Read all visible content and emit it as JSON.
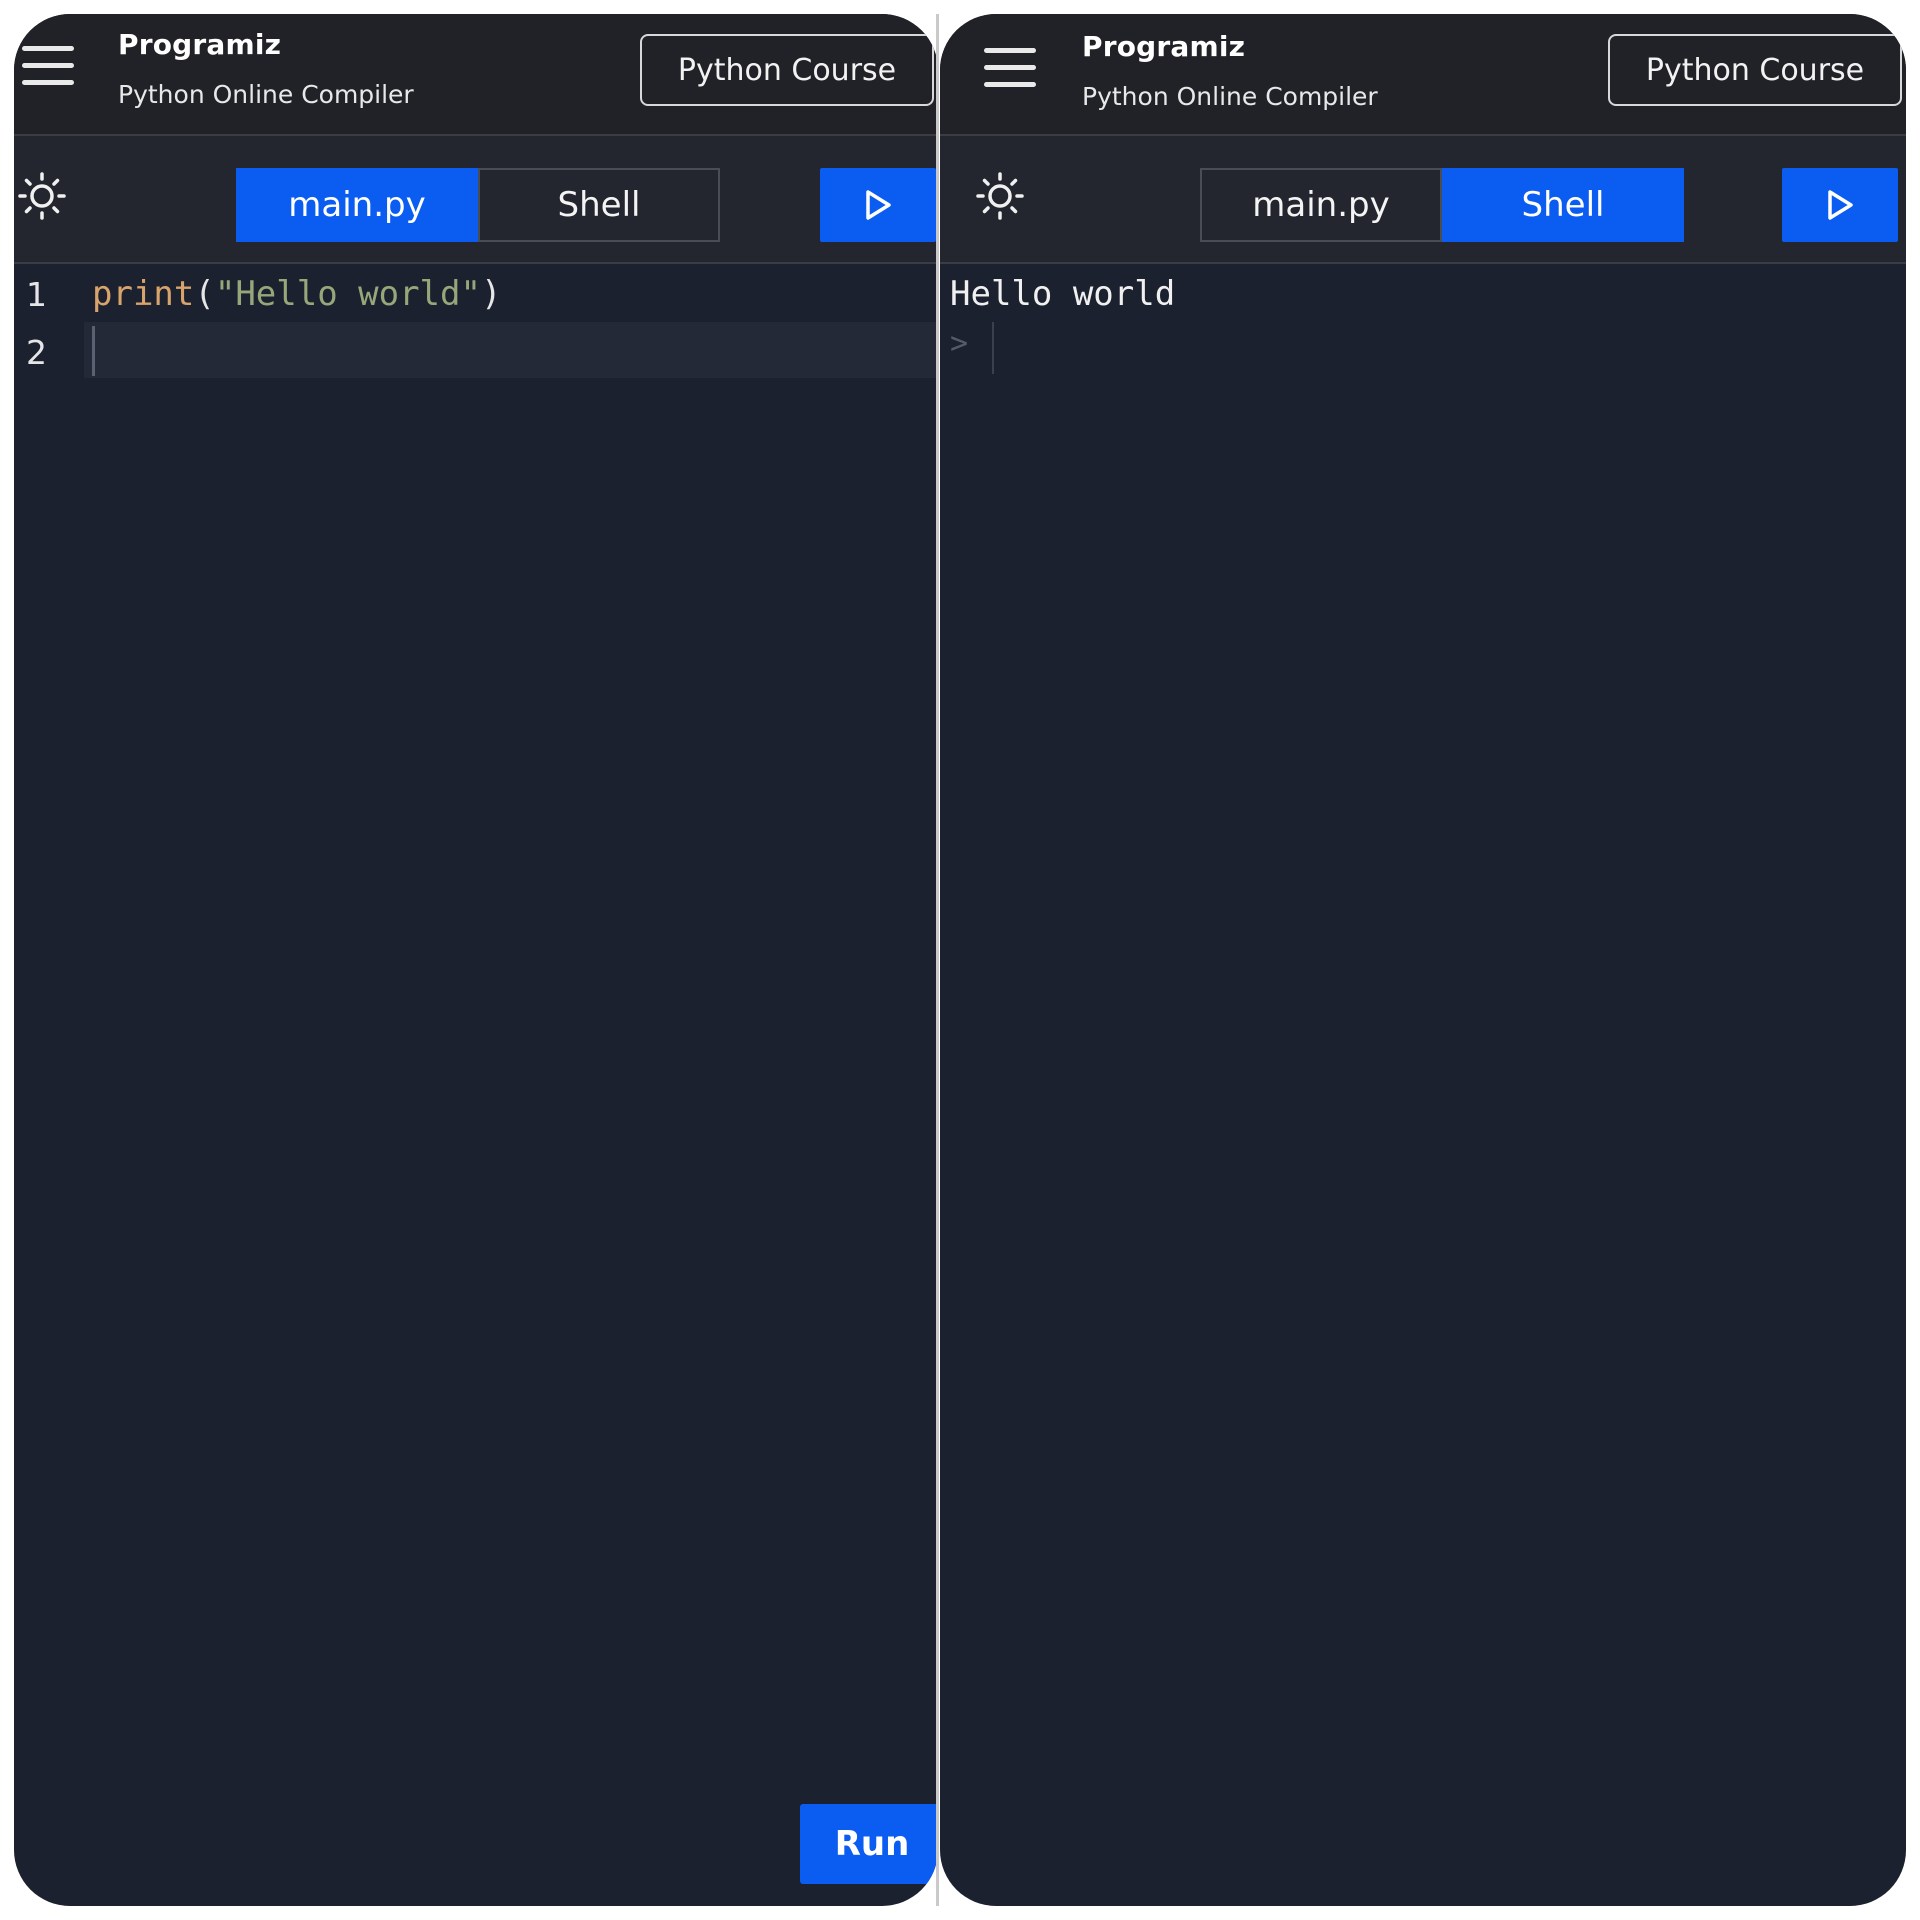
{
  "app": {
    "logo": "Programiz",
    "subtitle": "Python Online Compiler",
    "course_button": "Python Course"
  },
  "tabs": [
    {
      "label": "main.py"
    },
    {
      "label": "Shell"
    }
  ],
  "left_screen": {
    "active_tab": "main.py",
    "editor": {
      "line_numbers": [
        "1",
        "2"
      ],
      "code": {
        "fn": "print",
        "open": "(",
        "string": "\"Hello world\"",
        "close": ")"
      }
    },
    "run_button": "Run"
  },
  "right_screen": {
    "active_tab": "Shell",
    "shell": {
      "output": "Hello world",
      "prompt": ">"
    }
  },
  "colors": {
    "accent": "#0b5cf0",
    "background": "#1c2130",
    "header": "#202227"
  },
  "icons": [
    "menu-icon",
    "sun-icon",
    "play-icon"
  ]
}
